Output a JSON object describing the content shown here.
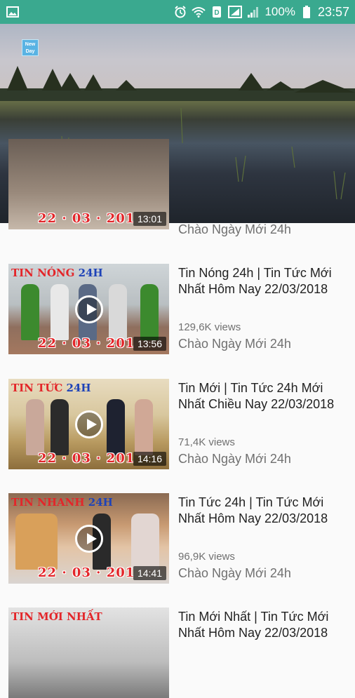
{
  "status_bar": {
    "battery": "100%",
    "time": "23:57"
  },
  "hero": {
    "logo_text": "New Day"
  },
  "videos": [
    {
      "date_overlay": "22 · 03 · 201",
      "duration": "13:01",
      "channel": "Chào Ngày Mới 24h"
    },
    {
      "ribbon": "TIN NÓNG",
      "ribbon_h": "24H",
      "date_overlay": "22 · 03 · 201",
      "duration": "13:56",
      "title": "Tin Nóng 24h | Tin Tức Mới Nhất Hôm Nay 22/03/2018",
      "views": "129,6K views",
      "channel": "Chào Ngày Mới 24h"
    },
    {
      "ribbon": "TIN TỨC",
      "ribbon_h": "24H",
      "date_overlay": "22 · 03 · 201",
      "duration": "14:16",
      "title": "Tin Mới | Tin Tức 24h Mới Nhất Chiều Nay 22/03/2018",
      "views": "71,4K views",
      "channel": "Chào Ngày Mới 24h"
    },
    {
      "ribbon": "TIN NHANH",
      "ribbon_h": "24H",
      "date_overlay": "22 · 03 · 201",
      "duration": "14:41",
      "title": "Tin Tức 24h | Tin Tức Mới Nhất Hôm Nay 22/03/2018",
      "views": "96,9K views",
      "channel": "Chào Ngày Mới 24h"
    },
    {
      "ribbon": "TIN MỚI NHẤT",
      "title": "Tin Mới Nhất | Tin Tức Mới Nhất Hôm Nay 22/03/2018"
    }
  ]
}
